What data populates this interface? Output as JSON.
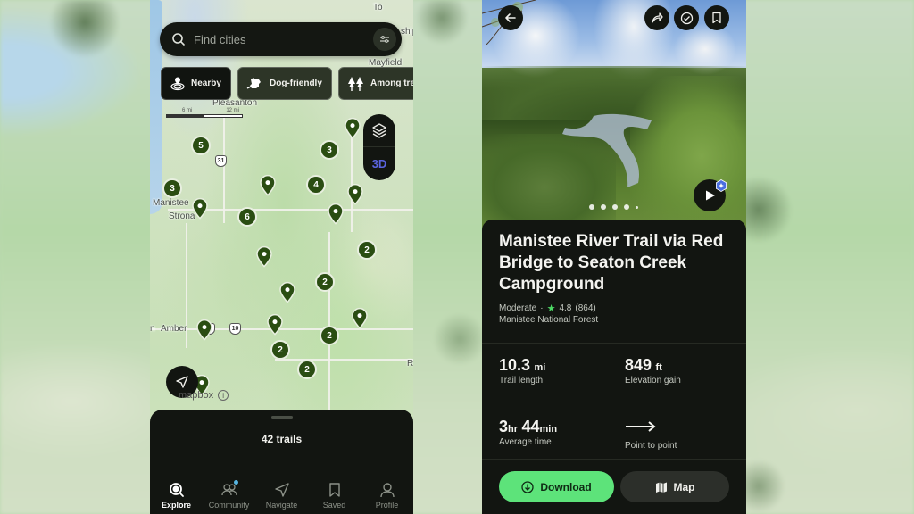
{
  "explore_screen": {
    "search": {
      "placeholder": "Find cities"
    },
    "chips": [
      {
        "label": "Nearby",
        "icon": "nearby-pin-icon",
        "active": true
      },
      {
        "label": "Dog-friendly",
        "icon": "dog-icon",
        "active": false
      },
      {
        "label": "Among trees",
        "icon": "trees-icon",
        "active": false
      }
    ],
    "scale": {
      "ticks": [
        "6 mi",
        "12 mi"
      ]
    },
    "map_labels": {
      "pleasanton": "Pleasanton",
      "mayfield": "Mayfield",
      "manistee": "Manistee",
      "stronach": "Strona",
      "amber": "Amber",
      "to": "To",
      "ship": "ship",
      "r": "R",
      "n": "n"
    },
    "highways": [
      "31",
      "10"
    ],
    "map_controls": {
      "layers_icon": "layers-icon",
      "btn_3d": "3D"
    },
    "clusters": [
      {
        "count": "5"
      },
      {
        "count": "3"
      },
      {
        "count": "3"
      },
      {
        "count": "4"
      },
      {
        "count": "6"
      },
      {
        "count": "2"
      },
      {
        "count": "2"
      },
      {
        "count": "2"
      },
      {
        "count": "2"
      },
      {
        "count": "2"
      }
    ],
    "attribution": "mapbox",
    "sheet": {
      "count_text": "42 trails"
    },
    "tabs": [
      {
        "label": "Explore",
        "icon": "explore-icon",
        "active": true
      },
      {
        "label": "Community",
        "icon": "community-icon",
        "active": false,
        "notification": true
      },
      {
        "label": "Navigate",
        "icon": "navigate-icon",
        "active": false
      },
      {
        "label": "Saved",
        "icon": "bookmark-icon",
        "active": false
      },
      {
        "label": "Profile",
        "icon": "profile-icon",
        "active": false
      }
    ]
  },
  "trail_screen": {
    "photo_pages": 5,
    "photo_current_page": 1,
    "title": "Manistee River Trail via Red Bridge to Seaton Creek Campground",
    "difficulty": "Moderate",
    "separator": "·",
    "rating": "4.8",
    "reviews": "(864)",
    "location": "Manistee National Forest",
    "stats": {
      "length": {
        "value": "10.3",
        "unit": "mi",
        "label": "Trail length"
      },
      "elevation": {
        "value": "849",
        "unit": "ft",
        "label": "Elevation gain"
      },
      "time": {
        "hours": "3",
        "hours_unit": "hr",
        "minutes": "44",
        "minutes_unit": "min",
        "label": "Average time"
      },
      "route": {
        "icon": "arrow-right-icon",
        "label": "Point to point"
      }
    },
    "buttons": {
      "download": "Download",
      "map": "Map"
    },
    "colors": {
      "accent_green": "#5de37a",
      "cluster_green": "#2a4d12",
      "badge_blue": "#4a6ee0"
    }
  }
}
